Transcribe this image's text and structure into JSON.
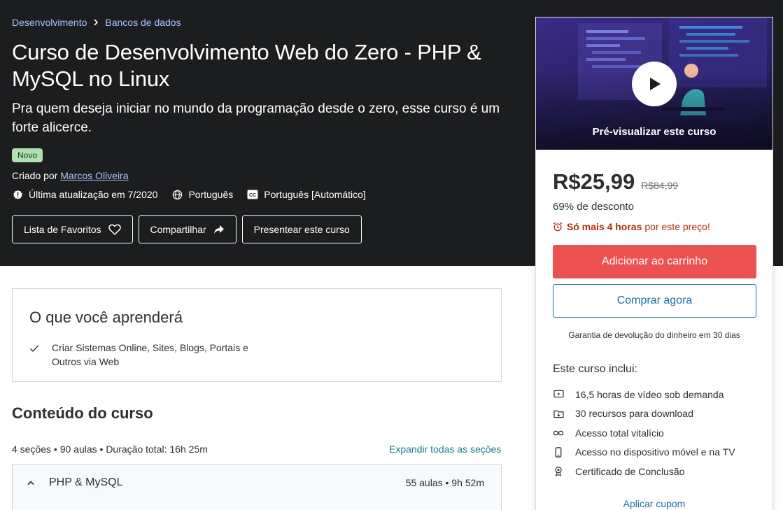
{
  "breadcrumb": {
    "items": [
      "Desenvolvimento",
      "Bancos de dados"
    ]
  },
  "course": {
    "title": "Curso de Desenvolvimento Web do Zero - PHP & MySQL no Linux",
    "subtitle": "Pra quem deseja iniciar no mundo da programação desde o zero, esse curso é um forte alicerce.",
    "badge": "Novo",
    "created_prefix": "Criado por",
    "author": "Marcos Oliveira",
    "updated": "Última atualização em 7/2020",
    "language": "Português",
    "captions": "Português [Automático]"
  },
  "actions": {
    "wishlist": "Lista de Favoritos",
    "share": "Compartilhar",
    "gift": "Presentear este curso"
  },
  "learn": {
    "title": "O que você aprenderá",
    "items": [
      "Criar Sistemas Online, Sites, Blogs, Portais e Outros via Web"
    ]
  },
  "content": {
    "title": "Conteúdo do curso",
    "meta": "4 seções • 90 aulas • Duração total: 16h 25m",
    "expand": "Expandir todas as seções",
    "sections": [
      {
        "name": "PHP & MySQL",
        "info": "55 aulas • 9h 52m"
      }
    ]
  },
  "sidebar": {
    "preview_label": "Pré-visualizar este curso",
    "price_now": "R$25,99",
    "price_old": "R$84,99",
    "discount": "69% de desconto",
    "timer_bold": "Só mais 4 horas",
    "timer_rest": "por este preço!",
    "add_to_cart": "Adicionar ao carrinho",
    "buy_now": "Comprar agora",
    "guarantee": "Garantia de devolução do dinheiro em 30 dias",
    "includes_title": "Este curso inclui:",
    "includes": [
      {
        "icon": "video-icon",
        "label": "16,5 horas de vídeo sob demanda"
      },
      {
        "icon": "download-icon",
        "label": "30 recursos para download"
      },
      {
        "icon": "infinity-icon",
        "label": "Acesso total vitalício"
      },
      {
        "icon": "mobile-icon",
        "label": "Acesso no dispositivo móvel e na TV"
      },
      {
        "icon": "certificate-icon",
        "label": "Certificado de Conclusão"
      }
    ],
    "coupon": "Aplicar cupom"
  },
  "colors": {
    "hero_bg": "#1c1d1f",
    "cart_button": "#ec5252",
    "timer": "#b32d0f",
    "link": "#1b6fa0"
  }
}
